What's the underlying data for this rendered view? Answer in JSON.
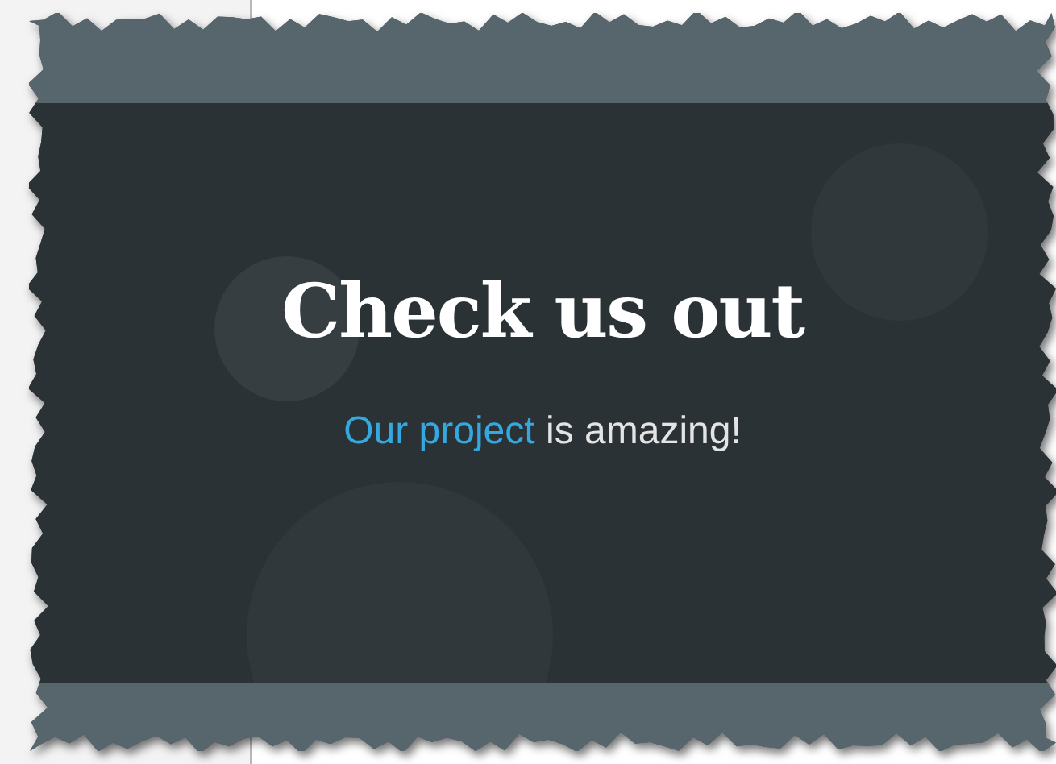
{
  "hero": {
    "title": "Check us out",
    "tagline": {
      "link": "Our project",
      "text": "is amazing!"
    }
  }
}
